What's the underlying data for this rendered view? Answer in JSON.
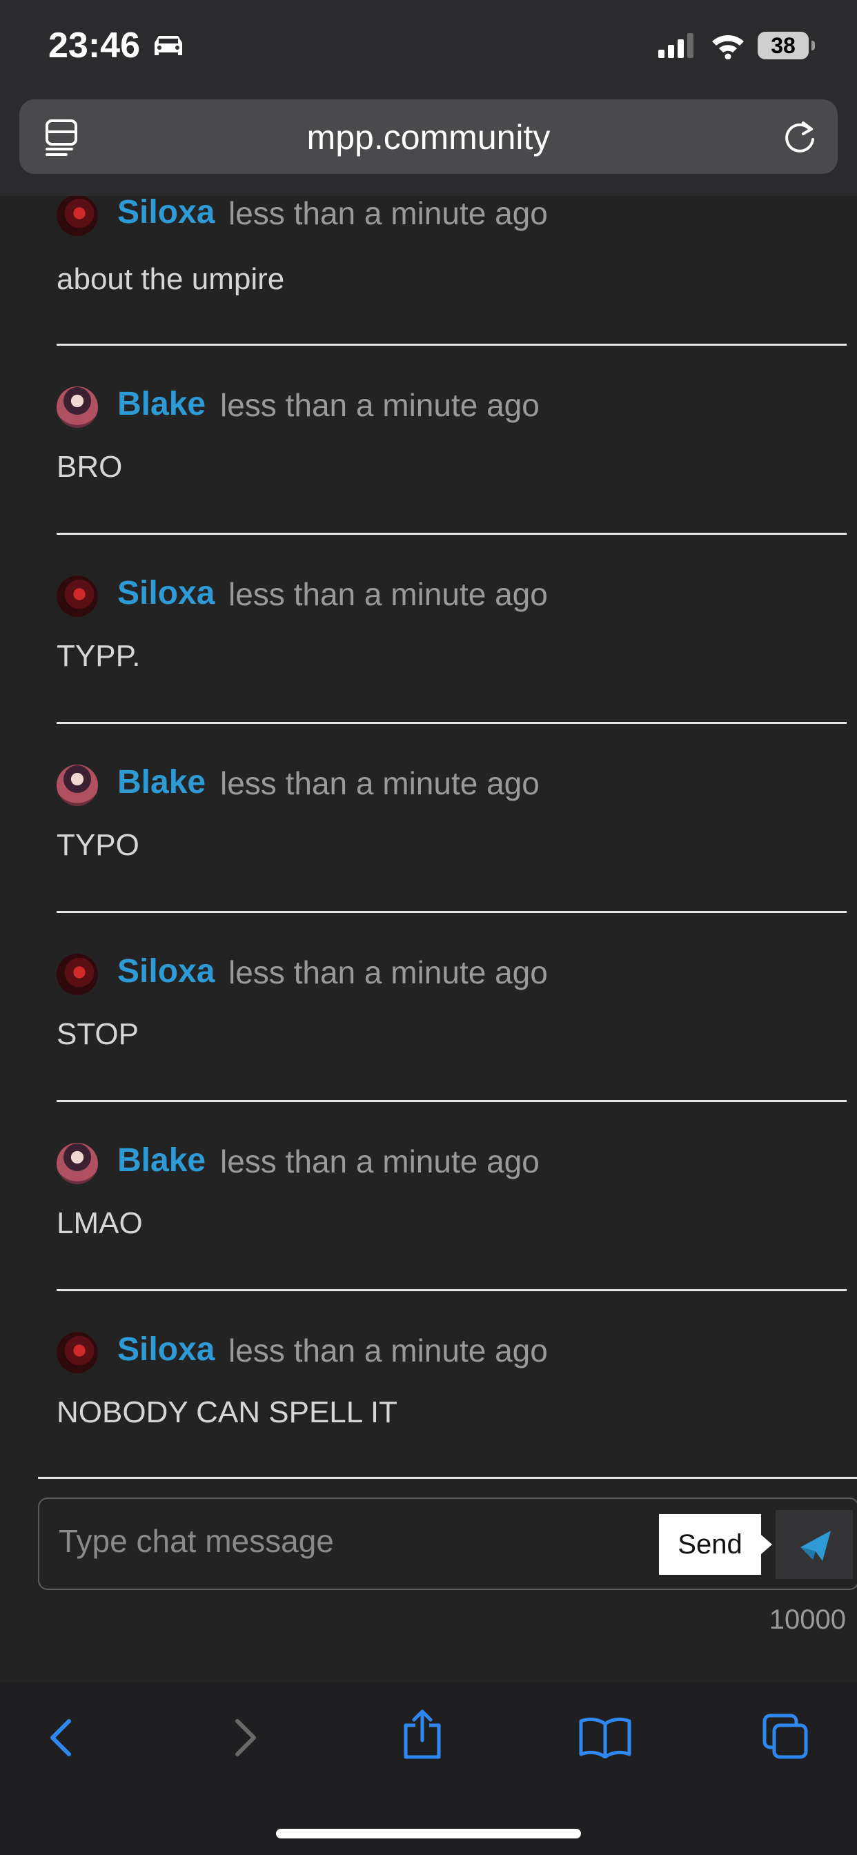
{
  "status_bar": {
    "time": "23:46",
    "battery": "38"
  },
  "browser": {
    "url": "mpp.community"
  },
  "messages": [
    {
      "user": "Siloxa",
      "avatar": "siloxa-avatar",
      "time": "less than a minute ago",
      "text": "about the umpire"
    },
    {
      "user": "Blake",
      "avatar": "blake-avatar",
      "time": "less than a minute ago",
      "text": "BRO"
    },
    {
      "user": "Siloxa",
      "avatar": "siloxa-avatar",
      "time": "less than a minute ago",
      "text": "TYPP."
    },
    {
      "user": "Blake",
      "avatar": "blake-avatar",
      "time": "less than a minute ago",
      "text": "TYPO"
    },
    {
      "user": "Siloxa",
      "avatar": "siloxa-avatar",
      "time": "less than a minute ago",
      "text": "STOP"
    },
    {
      "user": "Blake",
      "avatar": "blake-avatar",
      "time": "less than a minute ago",
      "text": "LMAO"
    },
    {
      "user": "Siloxa",
      "avatar": "siloxa-avatar",
      "time": "less than a minute ago",
      "text": "NOBODY CAN SPELL IT"
    }
  ],
  "composer": {
    "placeholder": "Type chat message",
    "send_tooltip": "Send",
    "char_count": "10000"
  },
  "colors": {
    "background": "#232323",
    "username": "#2e9ad6",
    "timestamp": "#9a9a9a",
    "message_text": "#d6d6d6",
    "accent": "#2e9ad6"
  }
}
